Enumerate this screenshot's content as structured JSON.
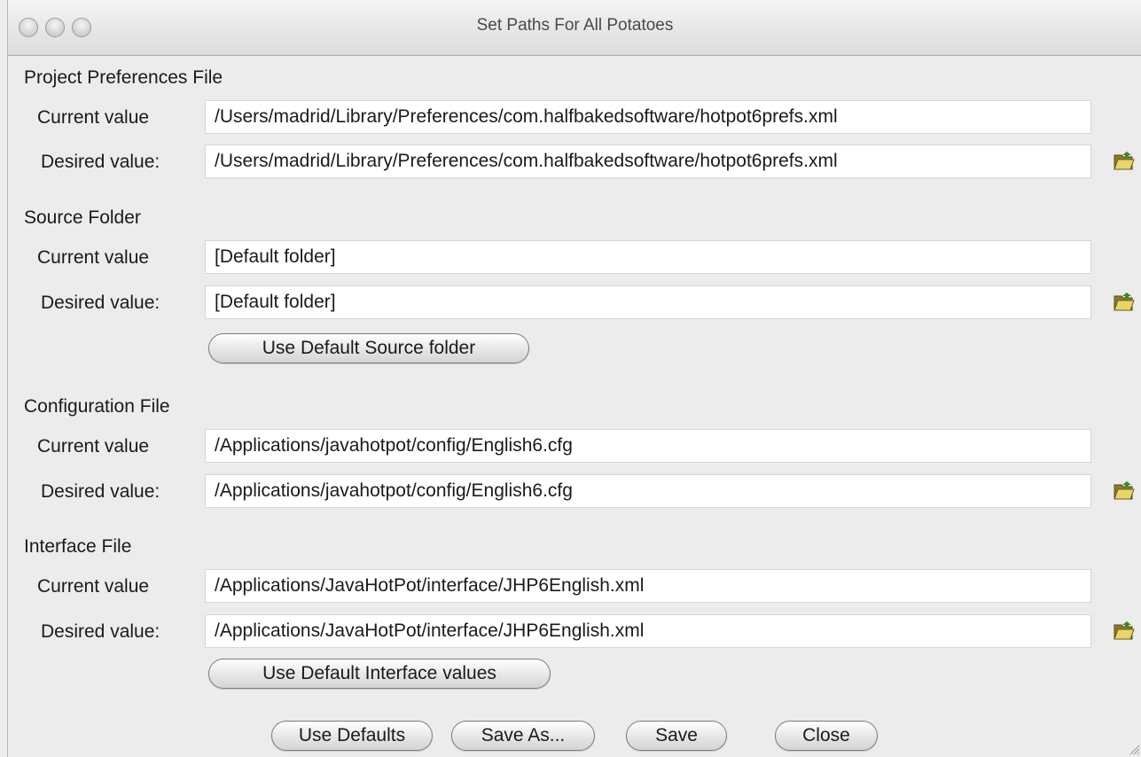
{
  "window": {
    "title": "Set Paths For All Potatoes"
  },
  "labels": {
    "current": "Current value",
    "desired": "Desired value:"
  },
  "sections": [
    {
      "title": "Project Preferences File",
      "current_value": "/Users/madrid/Library/Preferences/com.halfbakedsoftware/hotpot6prefs.xml",
      "desired_value": "/Users/madrid/Library/Preferences/com.halfbakedsoftware/hotpot6prefs.xml"
    },
    {
      "title": "Source Folder",
      "current_value": "[Default folder]",
      "desired_value": "[Default folder]",
      "default_button": "Use Default Source folder"
    },
    {
      "title": "Configuration File",
      "current_value": "/Applications/javahotpot/config/English6.cfg",
      "desired_value": "/Applications/javahotpot/config/English6.cfg"
    },
    {
      "title": "Interface File",
      "current_value": "/Applications/JavaHotPot/interface/JHP6English.xml",
      "desired_value": "/Applications/JavaHotPot/interface/JHP6English.xml",
      "default_button": "Use Default Interface values"
    }
  ],
  "footer": {
    "use_defaults": "Use Defaults",
    "save_as": "Save As...",
    "save": "Save",
    "close": "Close"
  },
  "icons": {
    "browse": "open-folder-icon"
  }
}
